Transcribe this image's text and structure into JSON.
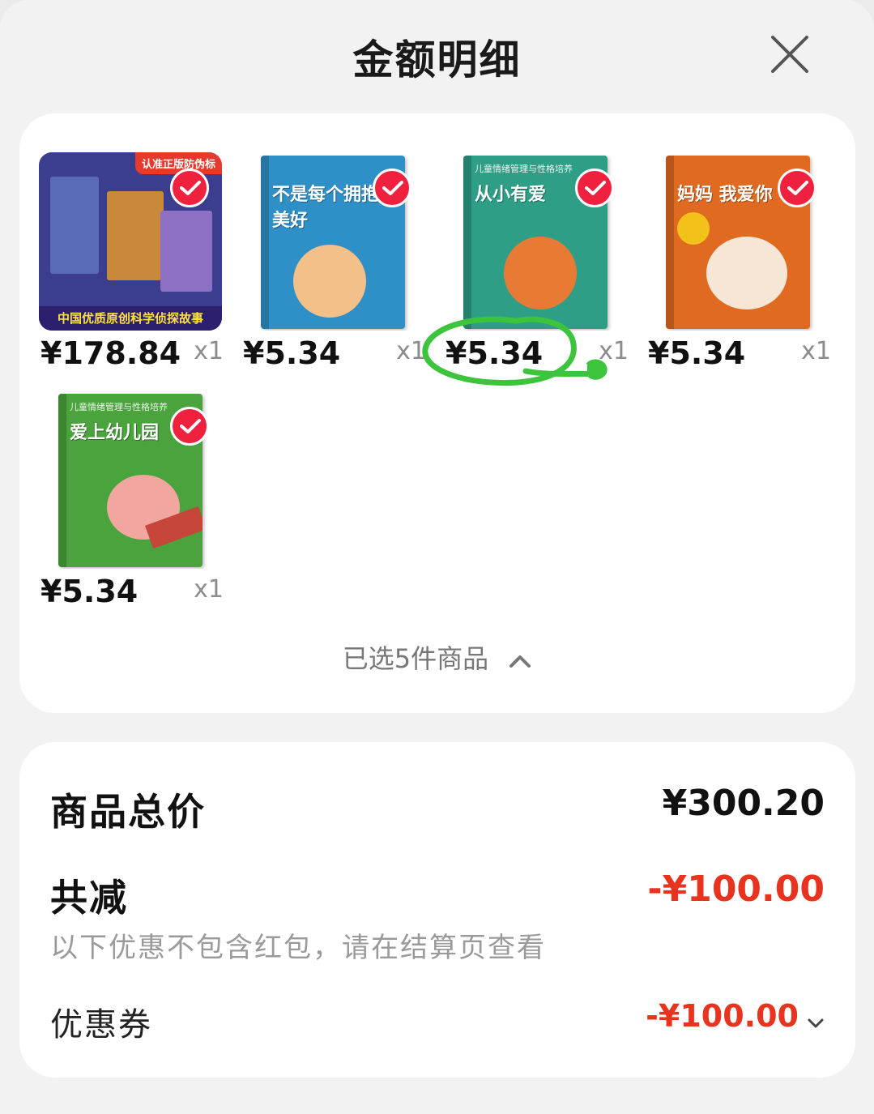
{
  "header": {
    "title": "金额明细"
  },
  "items": [
    {
      "price": "¥178.84",
      "qty": "x1",
      "cover_color": "#3b3d8f",
      "cover_title": "",
      "banner": "中国优质原创科学侦探故事",
      "top_tag": "认准正版防伪标"
    },
    {
      "price": "¥5.34",
      "qty": "x1",
      "cover_color": "#2f8fc7",
      "cover_title": "不是每个拥抱都美好"
    },
    {
      "price": "¥5.34",
      "qty": "x1",
      "cover_color": "#2e9e86",
      "cover_title": "从小有爱",
      "cover_sub": "儿童情绪管理与性格培养"
    },
    {
      "price": "¥5.34",
      "qty": "x1",
      "cover_color": "#e06a1f",
      "cover_title": "妈妈 我爱你"
    },
    {
      "price": "¥5.34",
      "qty": "x1",
      "cover_color": "#4aa33c",
      "cover_title": "爱上幼儿园",
      "cover_sub": "儿童情绪管理与性格培养"
    }
  ],
  "selected": {
    "label": "已选5件商品"
  },
  "summary": {
    "total_label": "商品总价",
    "total_value": "¥300.20",
    "discount_label": "共减",
    "discount_value": "-¥100.00",
    "note": "以下优惠不包含红包，请在结算页查看",
    "coupon_label": "优惠券",
    "coupon_value": "-¥100.00"
  },
  "colors": {
    "accent_red": "#e8331f",
    "check_red": "#f0213f",
    "annotation_green": "#3cc43c"
  }
}
